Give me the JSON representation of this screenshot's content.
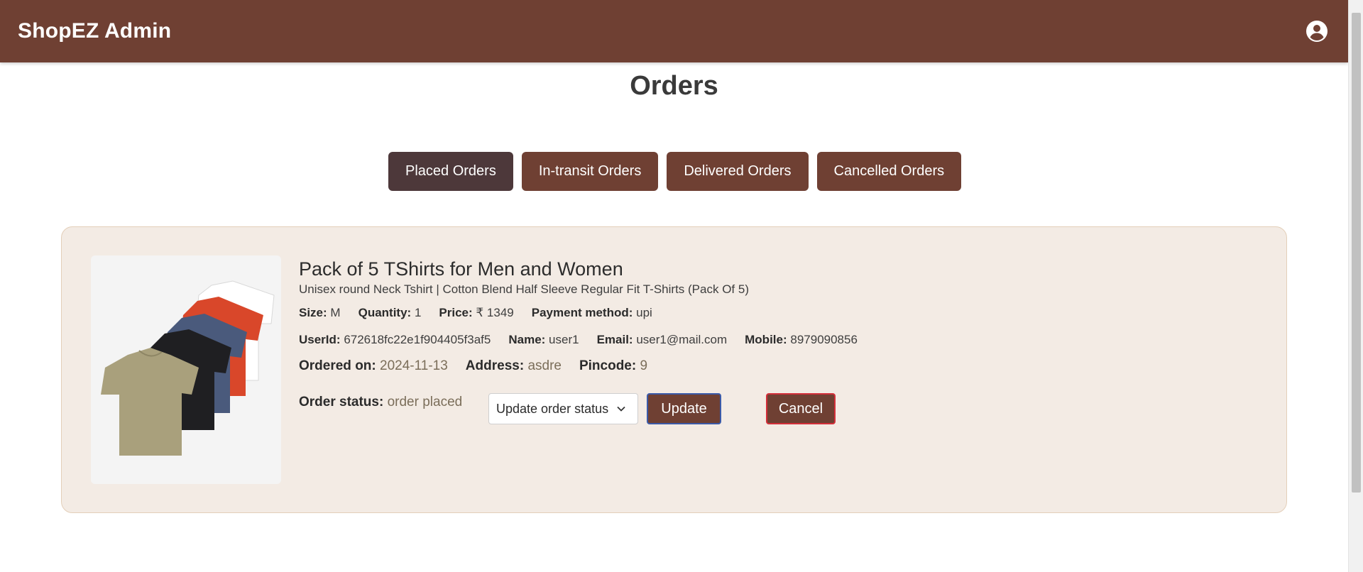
{
  "header": {
    "brand": "ShopEZ Admin",
    "profile_icon": "account-circle-icon"
  },
  "page": {
    "title": "Orders"
  },
  "tabs": [
    {
      "label": "Placed Orders",
      "active": true
    },
    {
      "label": "In-transit Orders",
      "active": false
    },
    {
      "label": "Delivered Orders",
      "active": false
    },
    {
      "label": "Cancelled Orders",
      "active": false
    }
  ],
  "order": {
    "image_alt": "tshirts-pack-image",
    "title": "Pack of 5 TShirts for Men and Women",
    "description": "Unisex round Neck Tshirt | Cotton Blend Half Sleeve Regular Fit T-Shirts (Pack Of 5)",
    "size_label": "Size:",
    "size": "M",
    "quantity_label": "Quantity:",
    "quantity": "1",
    "price_label": "Price:",
    "price": "₹ 1349",
    "payment_label": "Payment method:",
    "payment": "upi",
    "userid_label": "UserId:",
    "userid": "672618fc22e1f904405f3af5",
    "name_label": "Name:",
    "name": "user1",
    "email_label": "Email:",
    "email": "user1@mail.com",
    "mobile_label": "Mobile:",
    "mobile": "8979090856",
    "ordered_label": "Ordered on:",
    "ordered_on": "2024-11-13",
    "address_label": "Address:",
    "address": "asdre",
    "pincode_label": "Pincode:",
    "pincode": "9",
    "status_label": "Order status:",
    "status": "order placed",
    "select_placeholder": "Update order status",
    "update_label": "Update",
    "cancel_label": "Cancel"
  },
  "colors": {
    "primary": "#6f4033",
    "active_tab": "#4d383a",
    "card_bg": "#f3ebe4",
    "update_border": "#3b5aa8",
    "cancel_border": "#d32f3a"
  }
}
